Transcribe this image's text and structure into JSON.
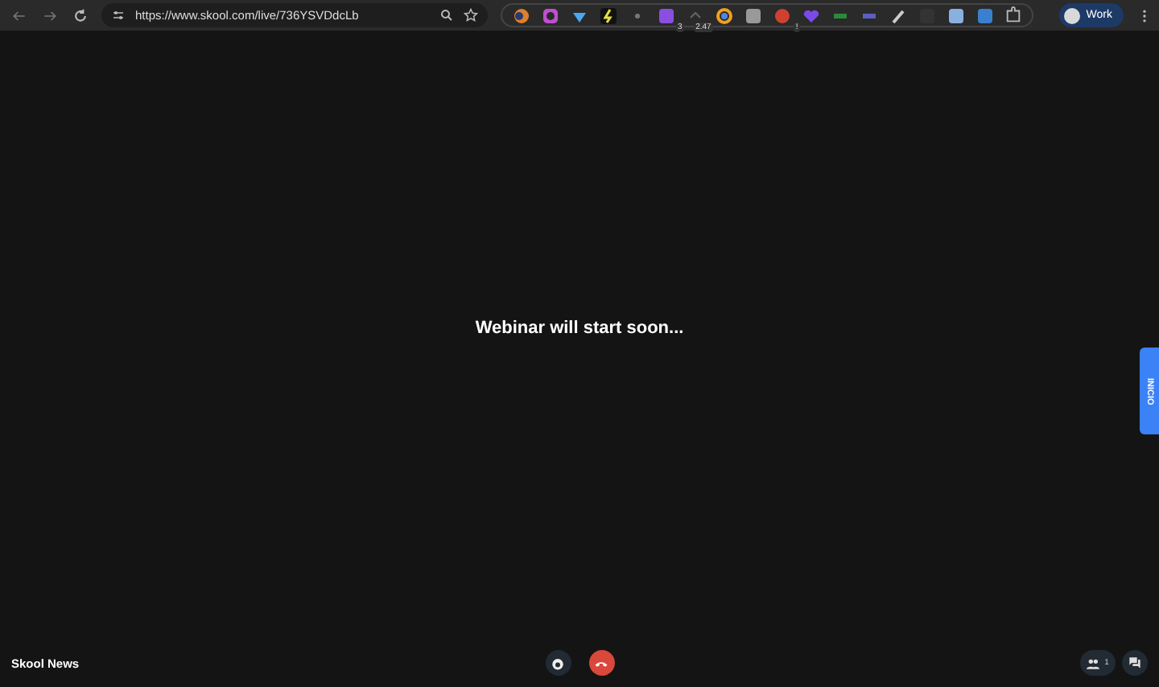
{
  "browser": {
    "url": "https://www.skool.com/live/736YSVDdcLb",
    "extensions": [
      {
        "kind": "sphere"
      },
      {
        "kind": "ring"
      },
      {
        "kind": "gem"
      },
      {
        "kind": "bolt"
      },
      {
        "kind": "dot"
      },
      {
        "kind": "tile",
        "badge": "3"
      },
      {
        "kind": "caret",
        "badge": "2.47"
      },
      {
        "kind": "wheel"
      },
      {
        "kind": "box"
      },
      {
        "kind": "ball",
        "badge": "!"
      },
      {
        "kind": "heart"
      },
      {
        "kind": "dash"
      },
      {
        "kind": "link"
      },
      {
        "kind": "pen"
      },
      {
        "kind": "terminal"
      },
      {
        "kind": "photo"
      },
      {
        "kind": "letter"
      }
    ],
    "profile": {
      "label": "Work"
    }
  },
  "stage": {
    "message": "Webinar will start soon...",
    "side_tab": "INICIO"
  },
  "bottom_bar": {
    "room_name": "Skool News",
    "participants": "1"
  }
}
